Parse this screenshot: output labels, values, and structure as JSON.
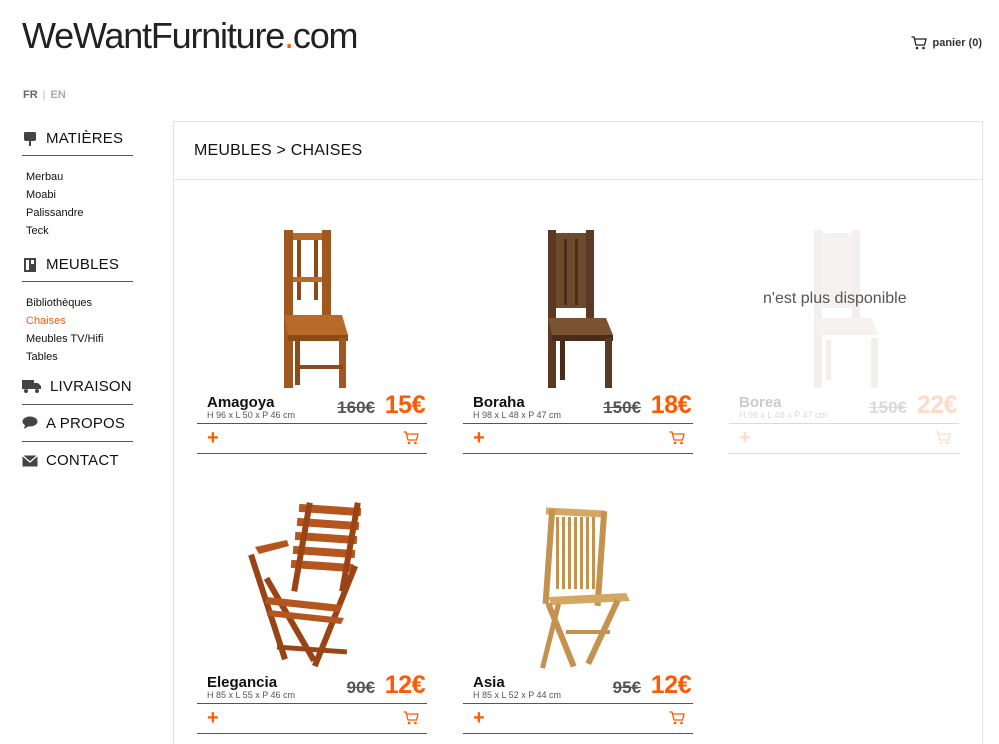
{
  "header": {
    "logo_main": "WeWantFurniture",
    "logo_dot": ".",
    "logo_tld": "com",
    "cart_label": "panier (0)"
  },
  "lang": {
    "fr": "FR",
    "sep": "|",
    "en": "EN"
  },
  "sidebar": {
    "materials": {
      "title": "MATIÈRES",
      "items": [
        "Merbau",
        "Moabi",
        "Palissandre",
        "Teck"
      ]
    },
    "furniture": {
      "title": "MEUBLES",
      "items": [
        "Bibliothèques",
        "Chaises",
        "Meubles TV/Hifi",
        "Tables"
      ],
      "active": "Chaises"
    },
    "delivery": "LIVRAISON",
    "about": "A PROPOS",
    "contact": "CONTACT"
  },
  "breadcrumb": "MEUBLES > CHAISES",
  "colors": {
    "accent": "#ff5a00",
    "text": "#111111",
    "border": "#e2e2e2"
  },
  "products": [
    {
      "name": "Amagoya",
      "dims": "H 96 x L 50 x P 46 cm",
      "old_price": "160€",
      "price": "15€",
      "available": true,
      "style": "dark-wood-tall"
    },
    {
      "name": "Boraha",
      "dims": "H 98 x L 48 x P 47 cm",
      "old_price": "150€",
      "price": "18€",
      "available": true,
      "style": "brown-wood-tall"
    },
    {
      "name": "Borea",
      "dims": "H 98 x L 48 x P 47 cm",
      "old_price": "150€",
      "price": "22€",
      "available": false,
      "unavailable_label": "n'est plus disponible",
      "style": "white-wood-tall"
    },
    {
      "name": "Elegancia",
      "dims": "H 85 x L 55 x P 46 cm",
      "old_price": "90€",
      "price": "12€",
      "available": true,
      "style": "folding-armchair"
    },
    {
      "name": "Asia",
      "dims": "H 85 x L 52 x P 44 cm",
      "old_price": "95€",
      "price": "12€",
      "available": true,
      "style": "teak-folding"
    }
  ],
  "product_actions": {
    "plus": "+",
    "add_to_cart_icon": "cart-icon"
  }
}
